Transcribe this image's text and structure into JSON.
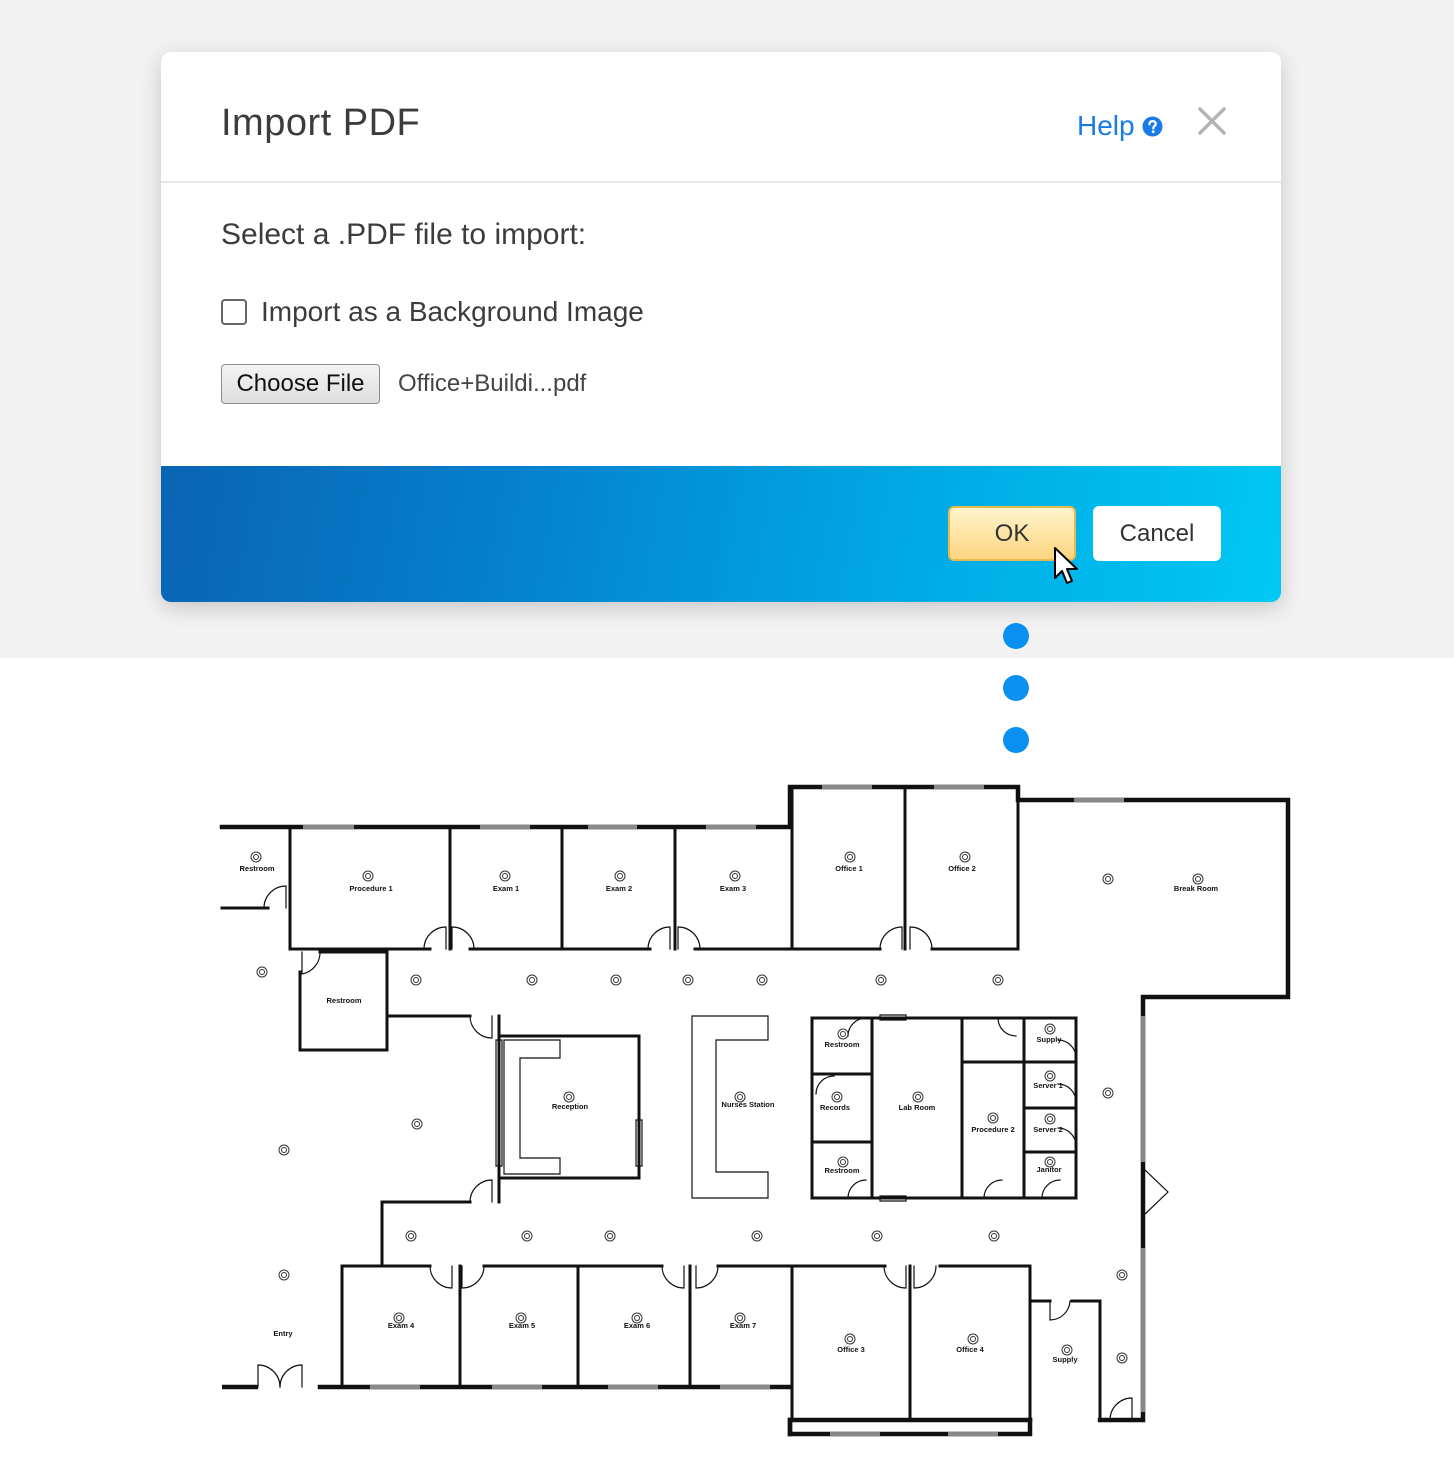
{
  "dialog": {
    "title": "Import PDF",
    "help_label": "Help",
    "prompt": "Select a .PDF file to import:",
    "checkbox_label": "Import as a Background Image",
    "checkbox_checked": false,
    "choose_file_label": "Choose File",
    "file_name": "Office+Buildi...pdf",
    "ok_label": "OK",
    "cancel_label": "Cancel",
    "help_icon": "question-circle-icon",
    "close_icon": "close-icon"
  },
  "colors": {
    "help_link": "#1a7be8",
    "footer_gradient_start": "#0a64b4",
    "footer_gradient_end": "#00c8f4",
    "ok_button": "#fcd57f",
    "dots": "#0a8ff3"
  },
  "floor_plan": {
    "rooms": {
      "restroom_a": "Restroom",
      "procedure_1": "Procedure 1",
      "exam_1": "Exam 1",
      "exam_2": "Exam 2",
      "exam_3": "Exam 3",
      "office_1": "Office 1",
      "office_2": "Office 2",
      "break_room": "Break Room",
      "restroom_b": "Restroom",
      "reception": "Reception",
      "nurses_station": "Nurses Station",
      "restroom_c": "Restroom",
      "records": "Records",
      "restroom_d": "Restroom",
      "lab_room": "Lab Room",
      "procedure_2": "Procedure 2",
      "supply_a": "Supply",
      "server_1": "Server 1",
      "server_2": "Server 2",
      "janitor": "Janitor",
      "entry": "Entry",
      "exam_4": "Exam 4",
      "exam_5": "Exam 5",
      "exam_6": "Exam 6",
      "exam_7": "Exam 7",
      "office_3": "Office 3",
      "office_4": "Office 4",
      "supply_b": "Supply"
    }
  }
}
